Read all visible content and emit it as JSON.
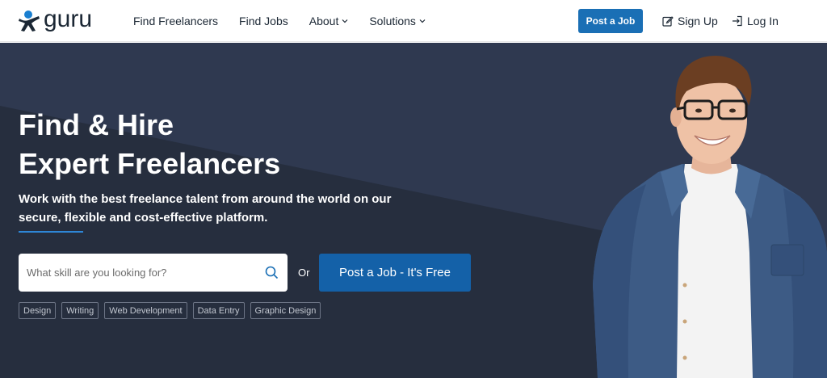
{
  "brand": {
    "name": "guru"
  },
  "nav": {
    "links": [
      {
        "label": "Find Freelancers",
        "dropdown": false
      },
      {
        "label": "Find Jobs",
        "dropdown": false
      },
      {
        "label": "About",
        "dropdown": true
      },
      {
        "label": "Solutions",
        "dropdown": true
      }
    ],
    "post_job_label": "Post a Job",
    "signup_label": "Sign Up",
    "login_label": "Log In"
  },
  "hero": {
    "headline_line1": "Find & Hire",
    "headline_line2": "Expert Freelancers",
    "subtitle": "Work with the best freelance talent from around the world on our secure, flexible and cost-effective platform.",
    "search_placeholder": "What skill are you looking for?",
    "or_text": "Or",
    "post_job_label": "Post a Job - It's Free",
    "tags": [
      "Design",
      "Writing",
      "Web Development",
      "Data Entry",
      "Graphic Design"
    ]
  },
  "colors": {
    "primary": "#1a6fb5",
    "hero_bg": "#262e3e",
    "hero_diag": "#2f3950",
    "accent": "#2e86d6"
  },
  "icons": [
    "guru-logo-icon",
    "chevron-down-icon",
    "edit-icon",
    "login-icon",
    "search-icon"
  ]
}
